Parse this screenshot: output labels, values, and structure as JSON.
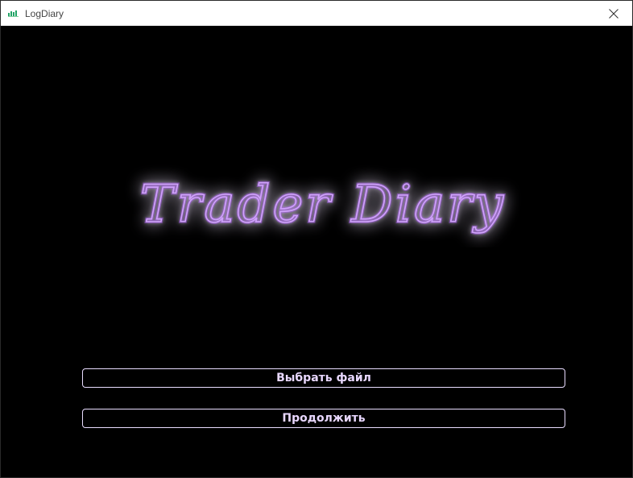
{
  "window": {
    "title": "LogDiary",
    "icon": "app-bar-chart-icon",
    "close_icon": "close-icon"
  },
  "main": {
    "logo_text": "Trader Diary",
    "logo_color": "#b57bff",
    "choose_file_label": "Выбрать файл",
    "continue_label": "Продолжить"
  },
  "colors": {
    "background": "#000000",
    "neon_purple": "#a855f7",
    "button_border": "#e9dcff",
    "button_text": "#e9d8ff"
  }
}
